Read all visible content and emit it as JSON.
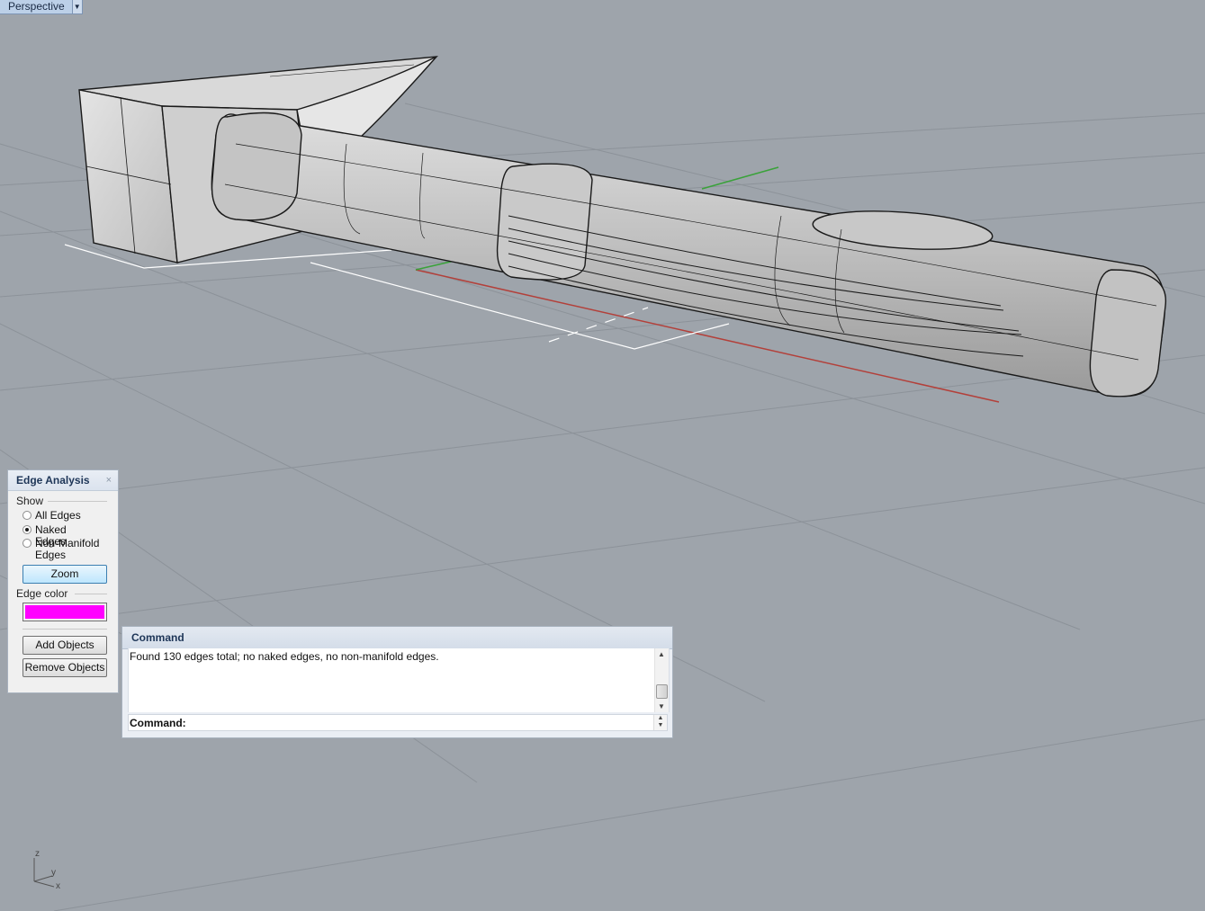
{
  "viewport": {
    "name": "Perspective"
  },
  "axis_labels": {
    "z": "z",
    "y": "y",
    "x": "x"
  },
  "edge_analysis": {
    "title": "Edge Analysis",
    "close_symbol": "×",
    "show_label": "Show",
    "options": [
      {
        "label": "All Edges",
        "selected": false
      },
      {
        "label": "Naked Edges",
        "selected": true
      },
      {
        "label": "Non-Manifold Edges",
        "selected": false
      }
    ],
    "zoom_label": "Zoom",
    "edge_color_label": "Edge color",
    "edge_color": "#ff00ff",
    "add_objects_label": "Add Objects",
    "remove_objects_label": "Remove Objects"
  },
  "command": {
    "title": "Command",
    "history": "Found 130 edges total; no naked edges, no non-manifold edges.",
    "prompt": "Command:",
    "input_value": ""
  },
  "colors": {
    "background": "#9ea4ab",
    "grid": "#8f959c",
    "x_axis": "#b3403a",
    "y_axis": "#3aa23a"
  }
}
